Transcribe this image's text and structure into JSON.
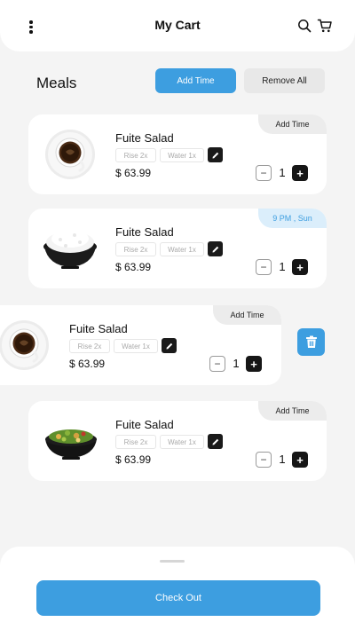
{
  "header": {
    "title": "My Cart",
    "menu_icon": "more-vertical-icon",
    "search_icon": "search-icon",
    "cart_icon": "cart-icon"
  },
  "section": {
    "title": "Meals",
    "add_time_label": "Add Time",
    "remove_all_label": "Remove All"
  },
  "colors": {
    "accent": "#3d9ee0",
    "dark": "#161616",
    "background": "#f4f4f4"
  },
  "cart_items": [
    {
      "name": "Fuite Salad",
      "tags": [
        "Rise 2x",
        "Water 1x"
      ],
      "price": "$ 63.99",
      "quantity": "1",
      "corner_label": "Add Time",
      "image": "coffee-cup"
    },
    {
      "name": "Fuite Salad",
      "tags": [
        "Rise 2x",
        "Water 1x"
      ],
      "price": "$ 63.99",
      "quantity": "1",
      "corner_label": "9 PM , Sun",
      "image": "rice-bowl"
    },
    {
      "name": "Fuite Salad",
      "tags": [
        "Rise 2x",
        "Water 1x"
      ],
      "price": "$ 63.99",
      "quantity": "1",
      "corner_label": "Add Time",
      "image": "coffee-cup",
      "swiped": true,
      "swipe_action": "delete-icon"
    },
    {
      "name": "Fuite Salad",
      "tags": [
        "Rise 2x",
        "Water 1x"
      ],
      "price": "$ 63.99",
      "quantity": "1",
      "corner_label": "Add Time",
      "image": "salad-bowl"
    }
  ],
  "checkout": {
    "label": "Check Out"
  }
}
